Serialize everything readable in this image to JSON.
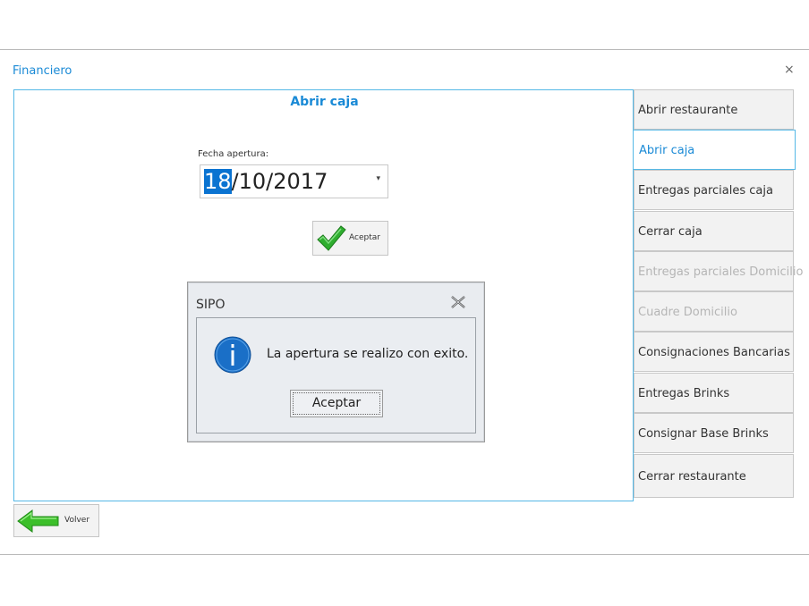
{
  "window": {
    "title": "Financiero",
    "close_glyph": "×"
  },
  "panel": {
    "title": "Abrir caja",
    "date_label": "Fecha apertura:",
    "date_day": "18",
    "date_rest": "/10/2017",
    "dropdown_glyph": "▾",
    "accept_label": "Aceptar"
  },
  "dialog": {
    "title": "SIPO",
    "message": "La apertura se realizo con exito.",
    "button_label": "Aceptar",
    "icon": "info-icon"
  },
  "side_menu": {
    "items": [
      {
        "label": "Abrir restaurante",
        "state": "normal"
      },
      {
        "label": "Abrir caja",
        "state": "active"
      },
      {
        "label": "Entregas parciales caja",
        "state": "normal"
      },
      {
        "label": "Cerrar caja",
        "state": "normal"
      },
      {
        "label": "Entregas parciales Domicilio",
        "state": "disabled"
      },
      {
        "label": "Cuadre Domicilio",
        "state": "disabled"
      },
      {
        "label": "Consignaciones Bancarias",
        "state": "normal"
      },
      {
        "label": "Entregas Brinks",
        "state": "normal"
      },
      {
        "label": "Consignar Base Brinks",
        "state": "normal"
      },
      {
        "label": "Cerrar restaurante",
        "state": "normal"
      }
    ]
  },
  "footer": {
    "back_label": "Volver"
  },
  "colors": {
    "accent": "#1a8ad6",
    "border_accent": "#55b8e6",
    "selection": "#0a73d1",
    "check_green": "#2fae2f"
  }
}
